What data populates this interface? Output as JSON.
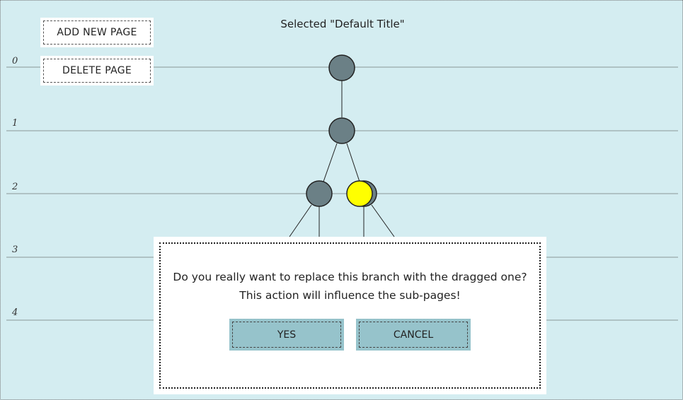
{
  "toolbar": {
    "add_label": "ADD NEW PAGE",
    "delete_label": "DELETE PAGE"
  },
  "status": {
    "selected_text": "Selected \"Default Title\""
  },
  "levels": [
    "0",
    "1",
    "2",
    "3",
    "4"
  ],
  "tree": {
    "node_color": "#6b8086",
    "highlight_color": "#ffff00",
    "line_color": "#8a9698",
    "background_color": "#d4edf1"
  },
  "dialog": {
    "line1": "Do you really want to replace this branch with the dragged one?",
    "line2": "This action will influence the sub-pages!",
    "yes_label": "YES",
    "cancel_label": "CANCEL"
  }
}
